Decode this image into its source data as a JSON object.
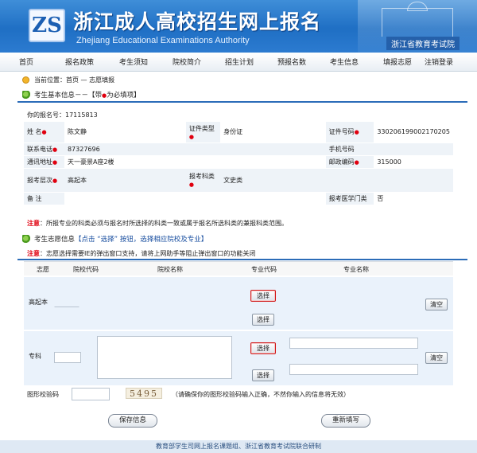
{
  "header": {
    "title": "浙江成人高校招生网上报名",
    "subtitle": "Zhejiang Educational Examinations Authority",
    "department": "浙江省教育考试院",
    "logo_text": "ZS"
  },
  "nav": [
    "首页",
    "报名政策",
    "考生须知",
    "院校简介",
    "招生计划",
    "预报名数",
    "考生信息",
    "填报志愿",
    "注销登录"
  ],
  "breadcrumb": "当前位置：首页 — 志愿填报",
  "basic_section": {
    "title_prefix": "考生基本信息－－【带",
    "title_suffix": "为必填项】",
    "reg_no_label": "你的报名号：",
    "reg_no": "17115813"
  },
  "fields": {
    "name_label": "姓  名",
    "name": "陈文静",
    "id_type_label": "证件类型",
    "id_type": "身份证",
    "id_no_label": "证件号码",
    "id_no": "330206199002170205",
    "phone_label": "联系电话",
    "phone": "87327696",
    "mobile_label": "手机号码",
    "mobile": "",
    "address_label": "通讯地址",
    "address": "天一豪景A座2楼",
    "postcode_label": "邮政编码",
    "postcode": "315000",
    "level_label": "报考层次",
    "level": "高起本",
    "category_label": "报考科类",
    "category": "文史类",
    "remark_label": "备  注",
    "remark": "",
    "medical_label": "报考医学门类",
    "medical": "否"
  },
  "notice1": {
    "bold": "注意",
    "text": "：所报专业的科类必须与报名时所选择的科类一致或属于报名所选科类的兼报科类范围。"
  },
  "volunteer_section": {
    "title_prefix": "考生志愿信息",
    "title_hint": "【点击 “选择” 按钮，选择相应院校及专业】"
  },
  "notice2": {
    "bold": "注意",
    "text": "：志愿选择需要IE的弹出窗口支持，请将上网助手等阻止弹出窗口的功能关闭"
  },
  "volunteer_table": {
    "headers": [
      "志愿",
      "院校代码",
      "院校名称",
      "专业代码",
      "专业名称"
    ],
    "rows": [
      {
        "label": "高起本",
        "select1": "选择",
        "select2": "选择",
        "clear": "清空"
      },
      {
        "label": "专科",
        "select1": "选择",
        "select2": "选择",
        "clear": "清空"
      }
    ]
  },
  "captcha": {
    "label": "图形校验码",
    "code": "5495",
    "hint": "（请确保你的图形校验码输入正确，不然你输入的信息将无效）"
  },
  "actions": {
    "save": "保存信息",
    "reset": "重新填写"
  },
  "footer": "教育部学生司网上报名课题组、浙江省教育考试院联合研制"
}
